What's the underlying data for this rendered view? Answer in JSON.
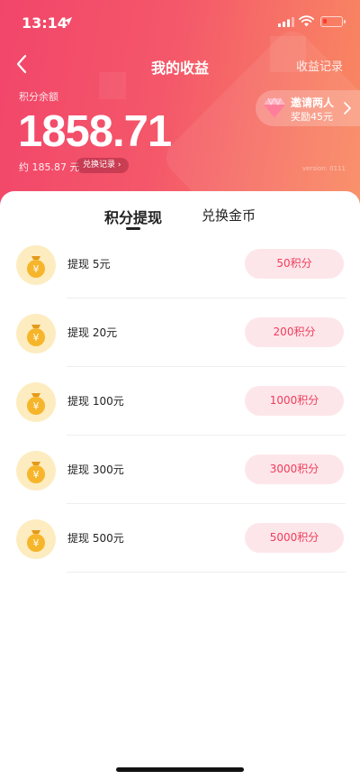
{
  "statusbar": {
    "time": "13:14"
  },
  "nav": {
    "title": "我的收益",
    "right_link": "收益记录"
  },
  "balance": {
    "label": "积分余额",
    "value": "1858.71",
    "approx": "约 185.87 元",
    "exchange_record": "兑换记录"
  },
  "invite": {
    "line1": "邀请两人",
    "line2": "奖励45元"
  },
  "version_text": "version: 0111",
  "tabs": [
    {
      "label": "积分提现",
      "active": true
    },
    {
      "label": "兑换金币",
      "active": false
    }
  ],
  "withdraw_options": [
    {
      "label": "提现 5元",
      "points": "50积分"
    },
    {
      "label": "提现 20元",
      "points": "200积分"
    },
    {
      "label": "提现 100元",
      "points": "1000积分"
    },
    {
      "label": "提现 300元",
      "points": "3000积分"
    },
    {
      "label": "提现 500元",
      "points": "5000积分"
    }
  ],
  "icons": {
    "back": "chevron-left-icon",
    "location": "location-arrow-icon",
    "gem": "diamond-gem-icon",
    "bag": "money-bag-icon"
  },
  "colors": {
    "header_start": "#f2456a",
    "header_end": "#f98a60",
    "accent": "#ee3d5b",
    "button_bg": "#fde6ea"
  }
}
